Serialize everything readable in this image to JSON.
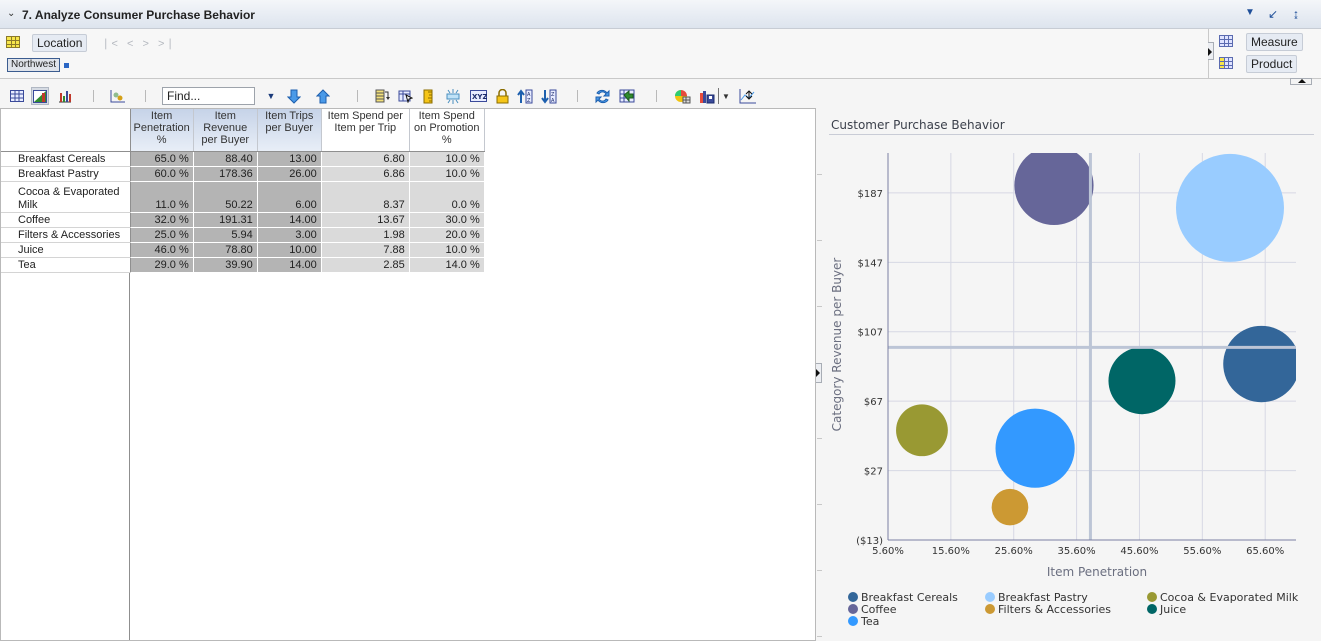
{
  "window": {
    "title": "7. Analyze Consumer Purchase Behavior",
    "icons": [
      "dropdown-arrow-icon",
      "minimize-icon",
      "restore-icon"
    ]
  },
  "pov": {
    "left_dimension": "Location",
    "selected_member": "Northwest",
    "nav_arrows": "∣< < > >∣",
    "right_dimensions": [
      "Measure",
      "Product"
    ]
  },
  "toolbar": {
    "find_value": "Find...",
    "buttons": [
      "grid-view",
      "grid-chart-view",
      "chart-view",
      "chart-type",
      "find-next",
      "find-previous",
      "pivot",
      "select",
      "ruler",
      "suppress",
      "xyz-format",
      "lock",
      "sort-ascending",
      "sort-descending",
      "refresh",
      "change-chart",
      "chart-properties",
      "save-chart",
      "more",
      "swap-axes"
    ]
  },
  "grid": {
    "columns": [
      {
        "label": "Item Penetration %",
        "lines": [
          "Item",
          "Penetration",
          "%"
        ],
        "selected": true
      },
      {
        "label": "Item Revenue per Buyer",
        "lines": [
          "Item",
          "Revenue",
          "per Buyer"
        ],
        "selected": true
      },
      {
        "label": "Item Trips per Buyer",
        "lines": [
          "Item Trips",
          "per Buyer"
        ],
        "selected": true
      },
      {
        "label": "Item Spend per Item per Trip",
        "lines": [
          "Item Spend per",
          "Item per Trip"
        ],
        "selected": false
      },
      {
        "label": "Item Spend on Promotion %",
        "lines": [
          "Item Spend",
          "on Promotion",
          "%"
        ],
        "selected": false
      }
    ],
    "rows": [
      {
        "label": "Breakfast Cereals",
        "values": [
          "65.0 %",
          "88.40",
          "13.00",
          "6.80",
          "10.0 %"
        ]
      },
      {
        "label": "Breakfast Pastry",
        "values": [
          "60.0 %",
          "178.36",
          "26.00",
          "6.86",
          "10.0 %"
        ]
      },
      {
        "label": "Cocoa & Evaporated Milk",
        "label_lines": [
          "Cocoa & Evaporated",
          "Milk"
        ],
        "values": [
          "11.0 %",
          "50.22",
          "6.00",
          "8.37",
          "0.0 %"
        ]
      },
      {
        "label": "Coffee",
        "values": [
          "32.0 %",
          "191.31",
          "14.00",
          "13.67",
          "30.0 %"
        ]
      },
      {
        "label": "Filters & Accessories",
        "values": [
          "25.0 %",
          "5.94",
          "3.00",
          "1.98",
          "20.0 %"
        ]
      },
      {
        "label": "Juice",
        "values": [
          "46.0 %",
          "78.80",
          "10.00",
          "7.88",
          "10.0 %"
        ]
      },
      {
        "label": "Tea",
        "values": [
          "29.0 %",
          "39.90",
          "14.00",
          "2.85",
          "14.0 %"
        ]
      }
    ]
  },
  "chart_data": {
    "type": "scatter",
    "subtype": "bubble",
    "title": "Customer Purchase Behavior",
    "xlabel": "Item Penetration",
    "ylabel": "Category Revenue per Buyer",
    "xlim": [
      5.6,
      70.5
    ],
    "ylim": [
      -13,
      210
    ],
    "x_ticks": [
      5.6,
      15.6,
      25.6,
      35.6,
      45.6,
      55.6,
      65.6
    ],
    "x_tick_labels": [
      "5.60%",
      "15.60%",
      "25.60%",
      "35.60%",
      "45.60%",
      "55.60%",
      "65.60%"
    ],
    "y_ticks": [
      -13,
      27,
      67,
      107,
      147,
      187
    ],
    "y_tick_labels": [
      "($13)",
      "$27",
      "$67",
      "$107",
      "$147",
      "$187"
    ],
    "grid": true,
    "reference_lines": {
      "x": 37.8,
      "y": 98
    },
    "size_measure": "Item Trips per Buyer",
    "legend_position": "bottom",
    "series": [
      {
        "name": "Breakfast Cereals",
        "x": 65.0,
        "y": 88.4,
        "size": 13,
        "color": "#336699"
      },
      {
        "name": "Breakfast Pastry",
        "x": 60.0,
        "y": 178.36,
        "size": 26,
        "color": "#99ccff"
      },
      {
        "name": "Cocoa & Evaporated Milk",
        "x": 11.0,
        "y": 50.22,
        "size": 6,
        "color": "#999933"
      },
      {
        "name": "Coffee",
        "x": 32.0,
        "y": 191.31,
        "size": 14,
        "color": "#666699"
      },
      {
        "name": "Filters & Accessories",
        "x": 25.0,
        "y": 5.94,
        "size": 3,
        "color": "#cc9933"
      },
      {
        "name": "Juice",
        "x": 46.0,
        "y": 78.8,
        "size": 10,
        "color": "#006666"
      },
      {
        "name": "Tea",
        "x": 29.0,
        "y": 39.9,
        "size": 14,
        "color": "#3399ff"
      }
    ]
  }
}
